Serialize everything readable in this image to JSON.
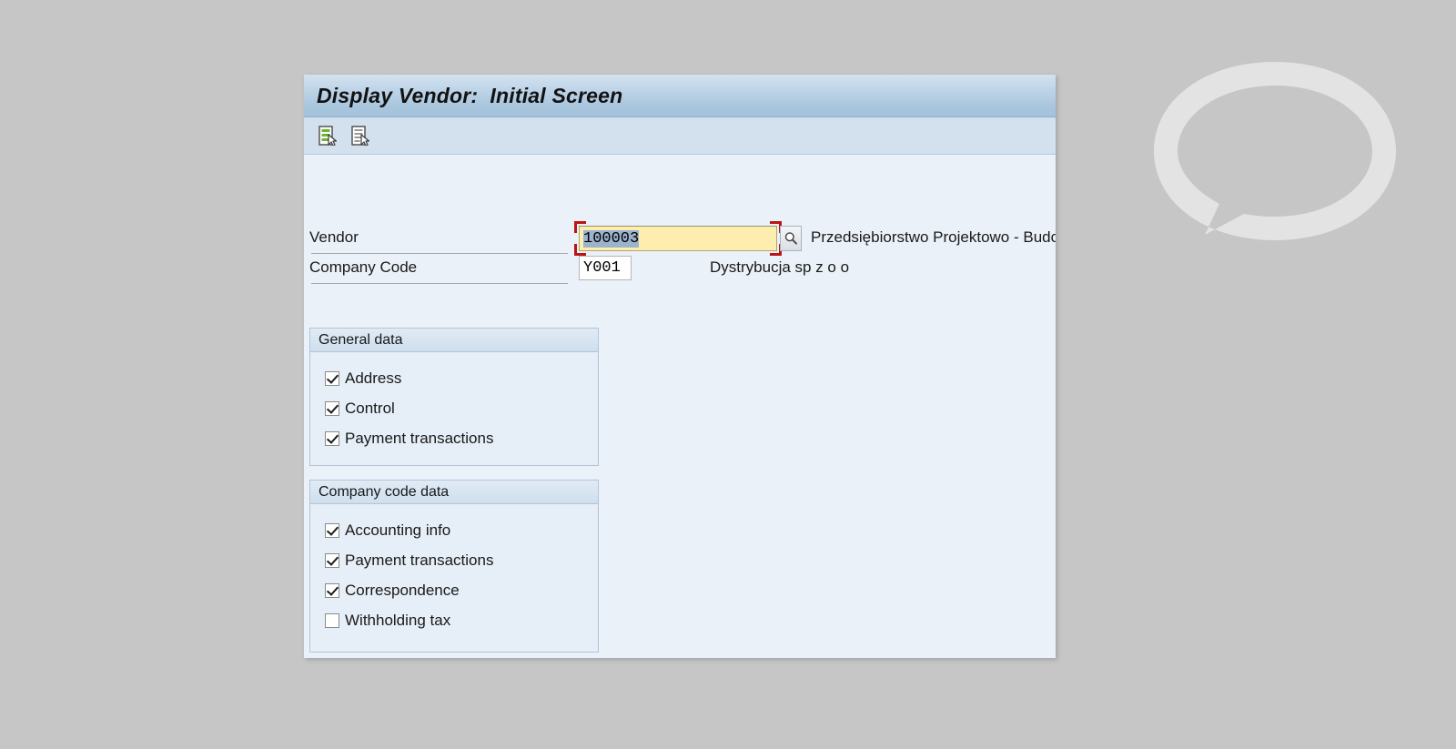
{
  "window": {
    "title": "Display Vendor:  Initial Screen"
  },
  "toolbar": {
    "buttons": [
      {
        "name": "display-vendor-list-icon",
        "title": "Vendor list",
        "accent": "#6cb52d"
      },
      {
        "name": "display-document-icon",
        "title": "Document",
        "accent": "#9a9a9a"
      }
    ]
  },
  "fields": {
    "vendor": {
      "label": "Vendor",
      "value": "100003",
      "placeholder": "",
      "description": "Przedsiębiorstwo Projektowo - Budowlane",
      "search_help_icon": "magnifier-icon",
      "focused": true
    },
    "company_code": {
      "label": "Company Code",
      "value": "Y001",
      "placeholder": "",
      "description": "Dystrybucja sp z o o"
    }
  },
  "panels": [
    {
      "name": "general-data",
      "title": "General data",
      "items": [
        {
          "label": "Address",
          "checked": true
        },
        {
          "label": "Control",
          "checked": true
        },
        {
          "label": "Payment transactions",
          "checked": true
        }
      ]
    },
    {
      "name": "company-code-data",
      "title": "Company code data",
      "items": [
        {
          "label": "Accounting info",
          "checked": true
        },
        {
          "label": "Payment transactions",
          "checked": true
        },
        {
          "label": "Correspondence",
          "checked": true
        },
        {
          "label": "Withholding tax",
          "checked": false
        }
      ]
    }
  ],
  "colors": {
    "desktop": "#c6c6c6",
    "window_background": "#eaf1f8",
    "titlebar_gradient_top": "#d3e2ef",
    "titlebar_gradient_bottom": "#a4c2db",
    "toolbar": "#d3e0ed",
    "required_field_yellow": "#fdeeb0",
    "focus_frame_red": "#bb1414",
    "selection_blue": "#9bb3cc",
    "panel_border": "#b3c4d6"
  }
}
